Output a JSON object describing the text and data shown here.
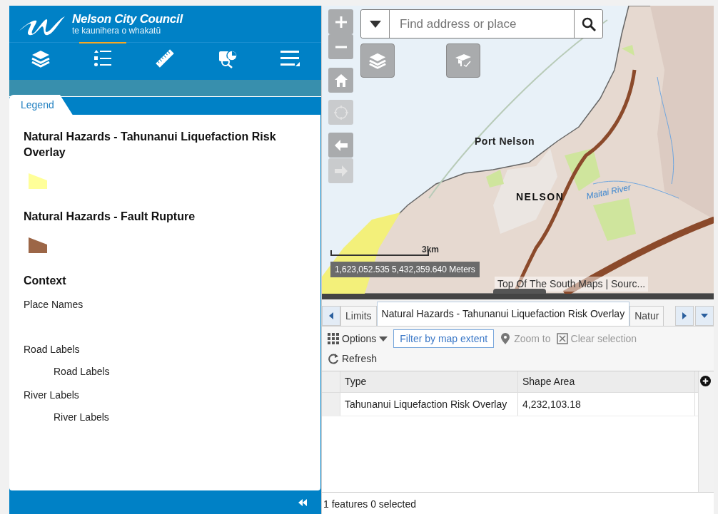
{
  "header": {
    "title": "Nelson City Council",
    "subtitle": "te kaunihera o whakatū"
  },
  "toolbar": [
    {
      "kind": "layers",
      "selected": false
    },
    {
      "kind": "legend",
      "selected": true
    },
    {
      "kind": "measure",
      "selected": false
    },
    {
      "kind": "report",
      "selected": false
    },
    {
      "kind": "table",
      "selected": false
    }
  ],
  "legend": {
    "tab": "Legend",
    "items": [
      {
        "kind": "layer",
        "title": "Natural Hazards - Tahunanui Liquefaction Risk Overlay",
        "color": "#ffff99"
      },
      {
        "kind": "layer",
        "title": "Natural Hazards - Fault Rupture",
        "color": "#9c6647"
      },
      {
        "kind": "group",
        "title": "Context",
        "children": [
          {
            "title": "Place Names"
          },
          {
            "title": "Road Labels",
            "children": [
              {
                "title": "Road Labels"
              }
            ]
          },
          {
            "title": "River Labels",
            "children": [
              {
                "title": "River Labels"
              }
            ]
          }
        ]
      }
    ]
  },
  "map": {
    "controls": [
      {
        "kind": "zoom-in",
        "disabled": false
      },
      {
        "kind": "zoom-out",
        "disabled": false
      },
      {
        "kind": "home",
        "disabled": false
      },
      {
        "kind": "locate",
        "disabled": true
      },
      {
        "kind": "back",
        "disabled": false
      },
      {
        "kind": "forward",
        "disabled": true
      }
    ],
    "search": {
      "placeholder": "Find address or place"
    },
    "labels": [
      {
        "text": "Port Nelson",
        "kind": "place"
      },
      {
        "text": "NELSON",
        "kind": "city"
      },
      {
        "text": "Maitai River",
        "kind": "river"
      }
    ],
    "scale": "3km",
    "coordinates": "1,623,052.535 5,432,359.640 Meters",
    "attribution": "Top Of The South Maps | Sourc..."
  },
  "table": {
    "tabs": [
      {
        "label": "Limits",
        "selected": false
      },
      {
        "label": "Natural Hazards - Tahunanui Liquefaction Risk Overlay",
        "selected": true
      },
      {
        "label": "Natur",
        "selected": false
      }
    ],
    "actions": [
      {
        "kind": "options",
        "label": "Options",
        "disabled": false
      },
      {
        "kind": "filter",
        "label": "Filter by map extent",
        "disabled": false
      },
      {
        "kind": "zoom",
        "label": "Zoom to",
        "disabled": true
      },
      {
        "kind": "clear",
        "label": "Clear selection",
        "disabled": true
      },
      {
        "kind": "refresh",
        "label": "Refresh",
        "disabled": false
      }
    ],
    "columns": [
      "Type",
      "Shape Area"
    ],
    "rows": [
      [
        "Tahunanui Liquefaction Risk Overlay",
        "4,232,103.18"
      ]
    ],
    "status": "1 features 0 selected"
  }
}
